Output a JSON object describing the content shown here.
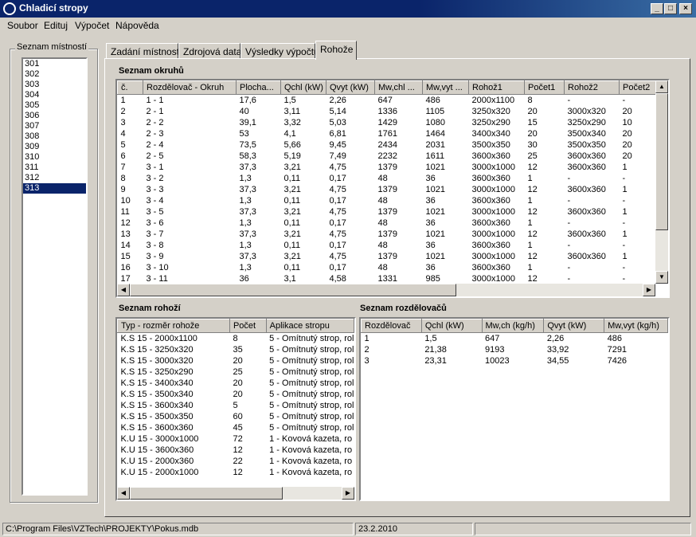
{
  "window": {
    "title": "Chladicí stropy",
    "min": "_",
    "max": "□",
    "close": "×"
  },
  "menu": [
    "Soubor",
    "Edituj",
    "Výpočet",
    "Nápověda"
  ],
  "rooms": {
    "title": "Seznam místností",
    "items": [
      "301",
      "302",
      "303",
      "304",
      "305",
      "306",
      "307",
      "308",
      "309",
      "310",
      "311",
      "312",
      "313"
    ],
    "selected": "313"
  },
  "tabs": [
    "Zadání místnosti",
    "Zdrojová data",
    "Výsledky výpočtu",
    "Rohože"
  ],
  "active_tab": "Rohože",
  "circuits": {
    "title": "Seznam okruhů",
    "columns": [
      "č.",
      "Rozdělovač - Okruh",
      "Plocha...",
      "Qchl (kW)",
      "Qvyt (kW)",
      "Mw,chl ...",
      "Mw,vyt ...",
      "Rohož1",
      "Počet1",
      "Rohož2",
      "Počet2"
    ],
    "rows": [
      [
        "1",
        "1 - 1",
        "17,6",
        "1,5",
        "2,26",
        "647",
        "486",
        "2000x1100",
        "8",
        "-",
        "-"
      ],
      [
        "2",
        "2 - 1",
        "40",
        "3,11",
        "5,14",
        "1336",
        "1105",
        "3250x320",
        "20",
        "3000x320",
        "20"
      ],
      [
        "3",
        "2 - 2",
        "39,1",
        "3,32",
        "5,03",
        "1429",
        "1080",
        "3250x290",
        "15",
        "3250x290",
        "10"
      ],
      [
        "4",
        "2 - 3",
        "53",
        "4,1",
        "6,81",
        "1761",
        "1464",
        "3400x340",
        "20",
        "3500x340",
        "20"
      ],
      [
        "5",
        "2 - 4",
        "73,5",
        "5,66",
        "9,45",
        "2434",
        "2031",
        "3500x350",
        "30",
        "3500x350",
        "20"
      ],
      [
        "6",
        "2 - 5",
        "58,3",
        "5,19",
        "7,49",
        "2232",
        "1611",
        "3600x360",
        "25",
        "3600x360",
        "20"
      ],
      [
        "7",
        "3 - 1",
        "37,3",
        "3,21",
        "4,75",
        "1379",
        "1021",
        "3000x1000",
        "12",
        "3600x360",
        "1"
      ],
      [
        "8",
        "3 - 2",
        "1,3",
        "0,11",
        "0,17",
        "48",
        "36",
        "3600x360",
        "1",
        "-",
        "-"
      ],
      [
        "9",
        "3 - 3",
        "37,3",
        "3,21",
        "4,75",
        "1379",
        "1021",
        "3000x1000",
        "12",
        "3600x360",
        "1"
      ],
      [
        "10",
        "3 - 4",
        "1,3",
        "0,11",
        "0,17",
        "48",
        "36",
        "3600x360",
        "1",
        "-",
        "-"
      ],
      [
        "11",
        "3 - 5",
        "37,3",
        "3,21",
        "4,75",
        "1379",
        "1021",
        "3000x1000",
        "12",
        "3600x360",
        "1"
      ],
      [
        "12",
        "3 - 6",
        "1,3",
        "0,11",
        "0,17",
        "48",
        "36",
        "3600x360",
        "1",
        "-",
        "-"
      ],
      [
        "13",
        "3 - 7",
        "37,3",
        "3,21",
        "4,75",
        "1379",
        "1021",
        "3000x1000",
        "12",
        "3600x360",
        "1"
      ],
      [
        "14",
        "3 - 8",
        "1,3",
        "0,11",
        "0,17",
        "48",
        "36",
        "3600x360",
        "1",
        "-",
        "-"
      ],
      [
        "15",
        "3 - 9",
        "37,3",
        "3,21",
        "4,75",
        "1379",
        "1021",
        "3000x1000",
        "12",
        "3600x360",
        "1"
      ],
      [
        "16",
        "3 - 10",
        "1,3",
        "0,11",
        "0,17",
        "48",
        "36",
        "3600x360",
        "1",
        "-",
        "-"
      ],
      [
        "17",
        "3 - 11",
        "36",
        "3,1",
        "4,58",
        "1331",
        "985",
        "3000x1000",
        "12",
        "-",
        "-"
      ]
    ]
  },
  "mats": {
    "title": "Seznam rohoží",
    "columns": [
      "Typ - rozměr rohože",
      "Počet",
      "Aplikace stropu"
    ],
    "rows": [
      [
        "K.S 15 - 2000x1100",
        "8",
        "5 - Omítnutý strop, rol"
      ],
      [
        "K.S 15 - 3250x320",
        "35",
        "5 - Omítnutý strop, rol"
      ],
      [
        "K.S 15 - 3000x320",
        "20",
        "5 - Omítnutý strop, rol"
      ],
      [
        "K.S 15 - 3250x290",
        "25",
        "5 - Omítnutý strop, rol"
      ],
      [
        "K.S 15 - 3400x340",
        "20",
        "5 - Omítnutý strop, rol"
      ],
      [
        "K.S 15 - 3500x340",
        "20",
        "5 - Omítnutý strop, rol"
      ],
      [
        "K.S 15 - 3600x340",
        "5",
        "5 - Omítnutý strop, rol"
      ],
      [
        "K.S 15 - 3500x350",
        "60",
        "5 - Omítnutý strop, rol"
      ],
      [
        "K.S 15 - 3600x360",
        "45",
        "5 - Omítnutý strop, rol"
      ],
      [
        "K.U 15 - 3000x1000",
        "72",
        "1 - Kovová kazeta, ro"
      ],
      [
        "K.U 15 - 3600x360",
        "12",
        "1 - Kovová kazeta, ro"
      ],
      [
        "K.U 15 - 2000x360",
        "22",
        "1 - Kovová kazeta, ro"
      ],
      [
        "K.U 15 - 2000x1000",
        "12",
        "1 - Kovová kazeta, ro"
      ]
    ]
  },
  "distributors": {
    "title": "Seznam rozdělovačů",
    "columns": [
      "Rozdělovač",
      "Qchl (kW)",
      "Mw,ch (kg/h)",
      "Qvyt (kW)",
      "Mw,vyt (kg/h)"
    ],
    "rows": [
      [
        "1",
        "1,5",
        "647",
        "2,26",
        "486"
      ],
      [
        "2",
        "21,38",
        "9193",
        "33,92",
        "7291"
      ],
      [
        "3",
        "23,31",
        "10023",
        "34,55",
        "7426"
      ]
    ]
  },
  "status": {
    "path": "C:\\Program Files\\VZTech\\PROJEKTY\\Pokus.mdb",
    "date": "23.2.2010",
    "extra": ""
  }
}
